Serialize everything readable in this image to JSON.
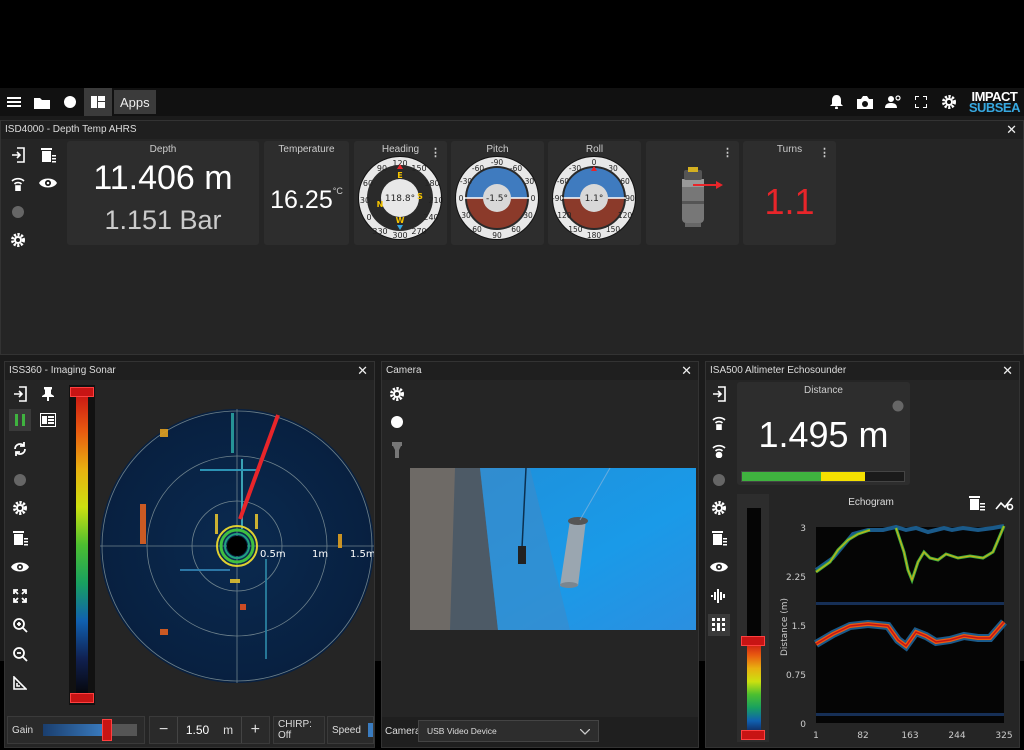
{
  "topbar": {
    "apps_label": "Apps",
    "logo_line1": "IMPACT",
    "logo_line2": "SUBSEA"
  },
  "depth_panel": {
    "title": "ISD4000 - Depth Temp  AHRS",
    "depth": {
      "label": "Depth",
      "value": "11.406 m",
      "pressure": "1.151 Bar"
    },
    "temperature": {
      "label": "Temperature",
      "value": "16.25",
      "unit": "°C"
    },
    "heading": {
      "label": "Heading",
      "value": "118.8°"
    },
    "pitch": {
      "label": "Pitch",
      "value": "-1.5°"
    },
    "roll": {
      "label": "Roll",
      "value": "1.1°"
    },
    "turns": {
      "label": "Turns",
      "value": "1.1"
    }
  },
  "sonar_panel": {
    "title": "ISS360 - Imaging Sonar",
    "range_labels": [
      "0.5m",
      "1m",
      "1.5m"
    ],
    "gain_label": "Gain",
    "gain_level": 0.78,
    "range_value": "1.50",
    "range_unit": "m",
    "minus": "−",
    "plus": "+",
    "chirp_label": "CHIRP: Off",
    "speed_label": "Speed"
  },
  "camera_panel": {
    "title": "Camera",
    "device_label": "Camera",
    "device_value": "USB Video Device"
  },
  "altimeter_panel": {
    "title": "ISA500 Altimeter  Echosounder",
    "distance_label": "Distance",
    "distance_value": "1.495 m",
    "echogram_title": "Echogram",
    "ylabel": "Distance (m)",
    "y_ticks": [
      "3",
      "2.25",
      "1.5",
      "0.75",
      "0"
    ],
    "x_ticks": [
      "1",
      "82",
      "163",
      "244",
      "325"
    ]
  },
  "colors": {
    "accent": "#37a8e0",
    "turns_red": "#e8252a",
    "green": "#3fb33f",
    "yellow": "#f5e000"
  }
}
